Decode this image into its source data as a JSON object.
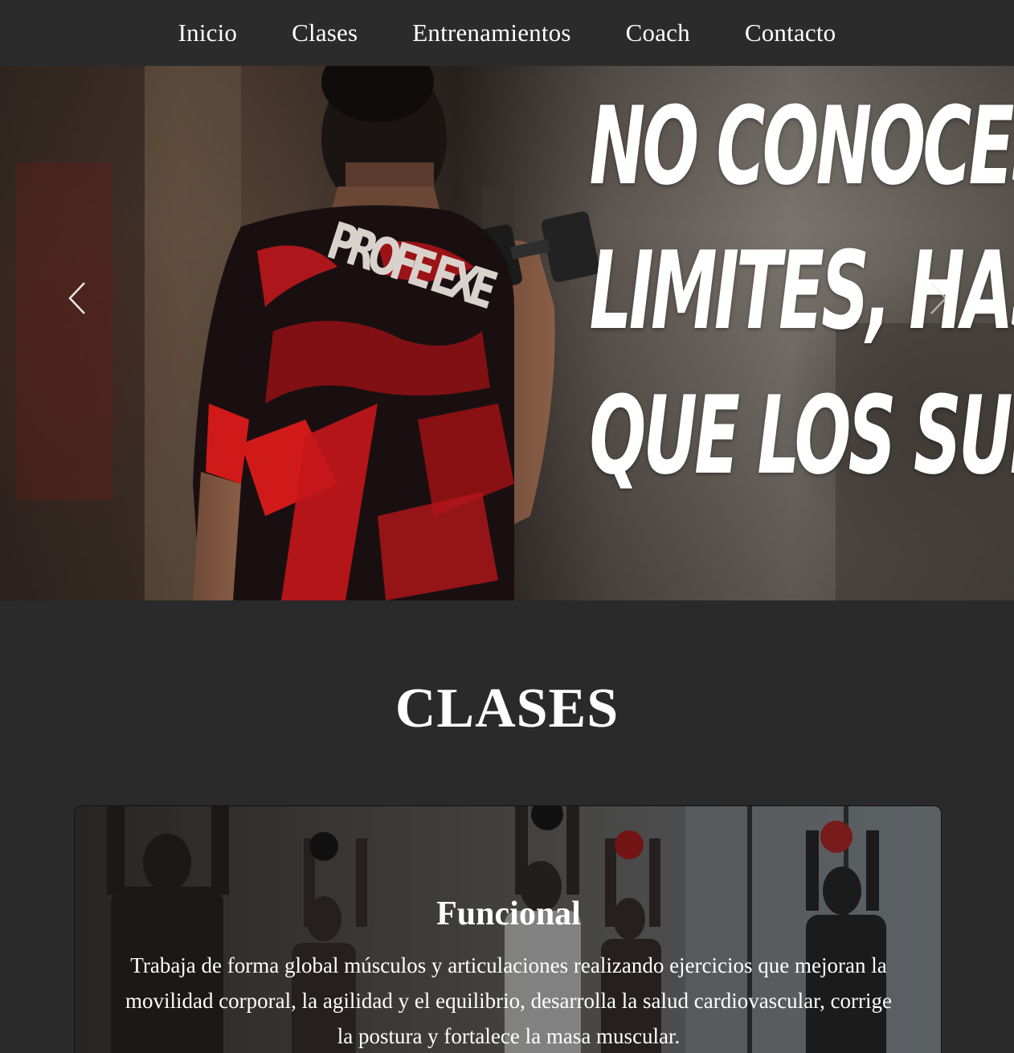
{
  "nav": {
    "items": [
      {
        "label": "Inicio"
      },
      {
        "label": "Clases"
      },
      {
        "label": "Entrenamientos"
      },
      {
        "label": "Coach"
      },
      {
        "label": "Contacto"
      }
    ]
  },
  "hero": {
    "title_lines": [
      "NO CONOCES TUS",
      "LIMITES, HASTA",
      "QUE LOS SUPERAS"
    ],
    "shirt_text": "PROFE EXE",
    "prev_icon": "chevron-left-icon",
    "next_icon": "chevron-right-icon"
  },
  "clases": {
    "title": "CLASES",
    "cards": [
      {
        "name": "Funcional",
        "description": "Trabaja de forma global músculos y articulaciones realizando ejercicios que mejoran la movilidad corporal, la agilidad y el equilibrio, desarrolla la salud cardiovascular, corrige la postura y fortalece la masa muscular."
      }
    ]
  },
  "colors": {
    "page_bg": "#2a2a2a",
    "nav_bg": "#2b2b2b",
    "text": "#ffffff",
    "shirt_red": "#d01a1a"
  }
}
